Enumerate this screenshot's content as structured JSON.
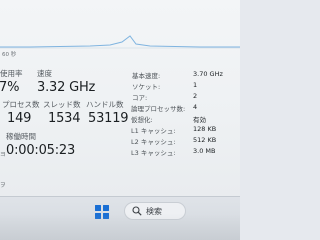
{
  "graph": {
    "time_label": "60 秒",
    "line_color": "#7fb4e0"
  },
  "left_stats": {
    "usage_label": "使用率",
    "usage_value": "7%",
    "speed_label": "速度",
    "speed_value": "3.32 GHz",
    "process_label": "プロセス数",
    "process_value": "149",
    "thread_label": "スレッド数",
    "thread_value": "1534",
    "handle_label": "ハンドル数",
    "handle_value": "53119",
    "uptime_label": "稼働時間",
    "uptime_value": "0:00:05:23"
  },
  "right_stats": {
    "rows": [
      {
        "label": "基本速度:",
        "value": "3.70 GHz"
      },
      {
        "label": "ソケット:",
        "value": "1"
      },
      {
        "label": "コア:",
        "value": "2"
      },
      {
        "label": "論理プロセッサ数:",
        "value": "4"
      },
      {
        "label": "仮想化:",
        "value": "有効"
      },
      {
        "label": "L1 キャッシュ:",
        "value": "128 KB"
      },
      {
        "label": "L2 キャッシュ:",
        "value": "512 KB"
      },
      {
        "label": "L3 キャッシュ:",
        "value": "3.0 MB"
      }
    ]
  },
  "taskbar": {
    "search_text": "検索",
    "accent": "#1a6fd4"
  }
}
